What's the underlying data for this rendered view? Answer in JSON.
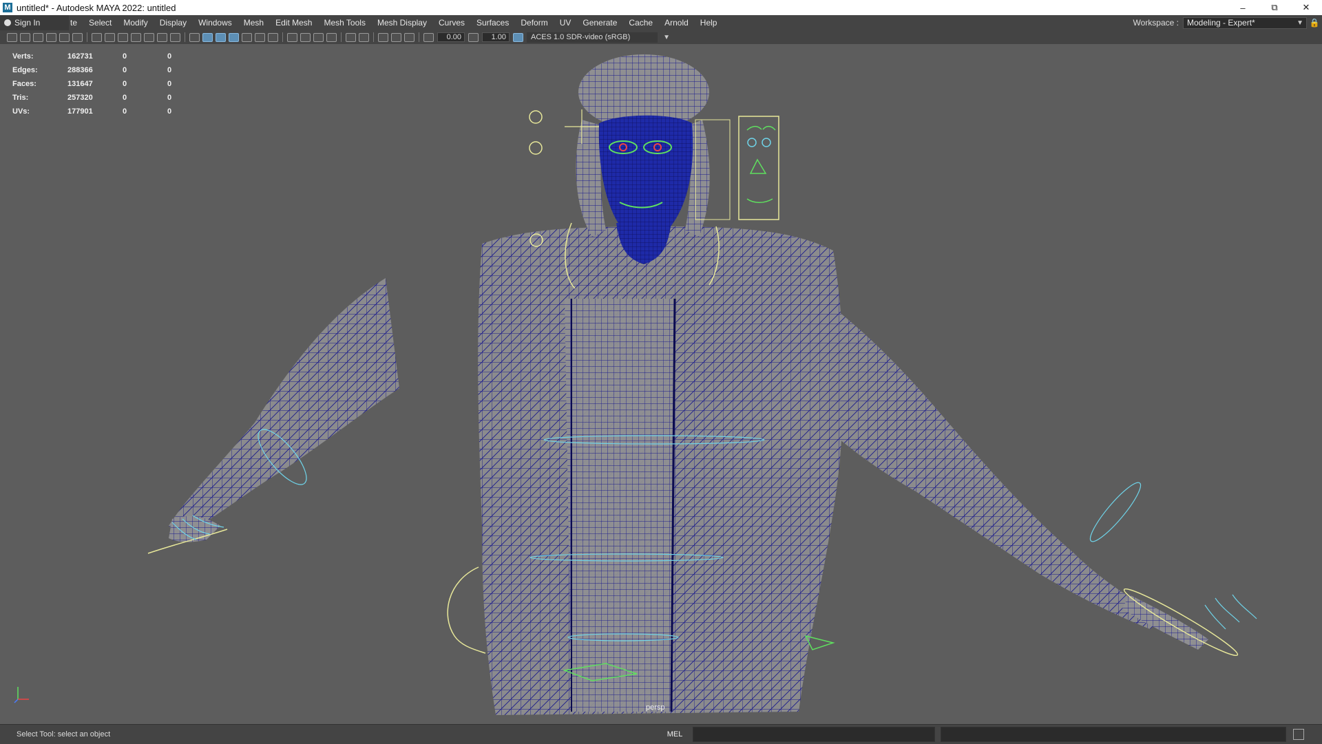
{
  "window": {
    "title": "untitled* - Autodesk MAYA 2022: untitled",
    "logo": "M",
    "controls": {
      "minimize": "–",
      "restore": "⧉",
      "close": "✕"
    }
  },
  "menubar": {
    "sign_in": "Sign In",
    "partial_item": "te",
    "items": [
      "Select",
      "Modify",
      "Display",
      "Windows",
      "Mesh",
      "Edit Mesh",
      "Mesh Tools",
      "Mesh Display",
      "Curves",
      "Surfaces",
      "Deform",
      "UV",
      "Generate",
      "Cache",
      "Arnold",
      "Help"
    ],
    "workspace_label": "Workspace :",
    "workspace_value": "Modeling - Expert*"
  },
  "panel_toolbar": {
    "exposure": "0.00",
    "gamma": "1.00",
    "color_space": "ACES 1.0 SDR-video (sRGB)"
  },
  "hud": {
    "rows": [
      {
        "label": "Verts:",
        "value": "162731",
        "a": "0",
        "b": "0"
      },
      {
        "label": "Edges:",
        "value": "288366",
        "a": "0",
        "b": "0"
      },
      {
        "label": "Faces:",
        "value": "131647",
        "a": "0",
        "b": "0"
      },
      {
        "label": "Tris:",
        "value": "257320",
        "a": "0",
        "b": "0"
      },
      {
        "label": "UVs:",
        "value": "177901",
        "a": "0",
        "b": "0"
      }
    ]
  },
  "viewport": {
    "camera_label": "persp",
    "colors": {
      "background": "#5d5d5d",
      "wire": "#1a1a8c",
      "mesh": "#8a8a8a",
      "rig_yellow": "#e8e89a",
      "rig_cyan": "#6fd3e8",
      "rig_green": "#5fe05f"
    }
  },
  "helpline": {
    "message": "Select Tool: select an object",
    "mel_label": "MEL"
  }
}
